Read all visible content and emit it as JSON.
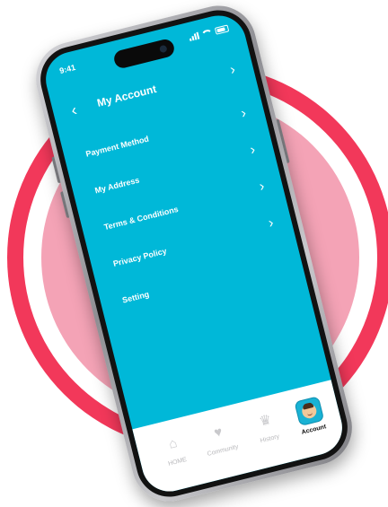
{
  "status_bar": {
    "time": "9:41"
  },
  "header": {
    "title": "My Account"
  },
  "menu": {
    "items": [
      {
        "label": "Payment Method",
        "has_chevron": true
      },
      {
        "label": "My Address",
        "has_chevron": true
      },
      {
        "label": "Terms & Conditions",
        "has_chevron": true
      },
      {
        "label": "Privacy Policy",
        "has_chevron": true
      },
      {
        "label": "Setting",
        "has_chevron": false
      }
    ]
  },
  "tab_bar": {
    "tabs": [
      {
        "label": "HOME",
        "icon": "home-icon",
        "active": false
      },
      {
        "label": "Community",
        "icon": "community-icon",
        "active": false
      },
      {
        "label": "History",
        "icon": "crown-icon",
        "active": false
      },
      {
        "label": "Account",
        "icon": "avatar-icon",
        "active": true
      }
    ]
  },
  "colors": {
    "screen_bg": "#00b8d8",
    "ring": "#f2385a",
    "ring_fill": "#f4a3b6",
    "active_tab": "#19b2d4"
  }
}
